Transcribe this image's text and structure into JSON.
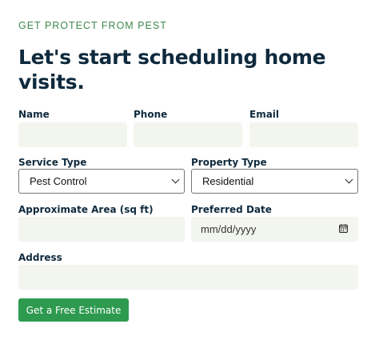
{
  "eyebrow": "GET PROTECT FROM PEST",
  "headline": "Let's start scheduling home visits.",
  "form": {
    "name_label": "Name",
    "phone_label": "Phone",
    "email_label": "Email",
    "service_type_label": "Service Type",
    "service_type_value": "Pest Control",
    "property_type_label": "Property Type",
    "property_type_value": "Residential",
    "area_label": "Approximate Area (sq ft)",
    "date_label": "Preferred Date",
    "date_placeholder": "mm/dd/yyyy",
    "address_label": "Address",
    "submit_label": "Get a Free Estimate"
  },
  "colors": {
    "accent": "#2e9a4f",
    "field_bg": "#f3f5ef",
    "heading": "#0f2a3d",
    "eyebrow": "#3f8a4e"
  }
}
